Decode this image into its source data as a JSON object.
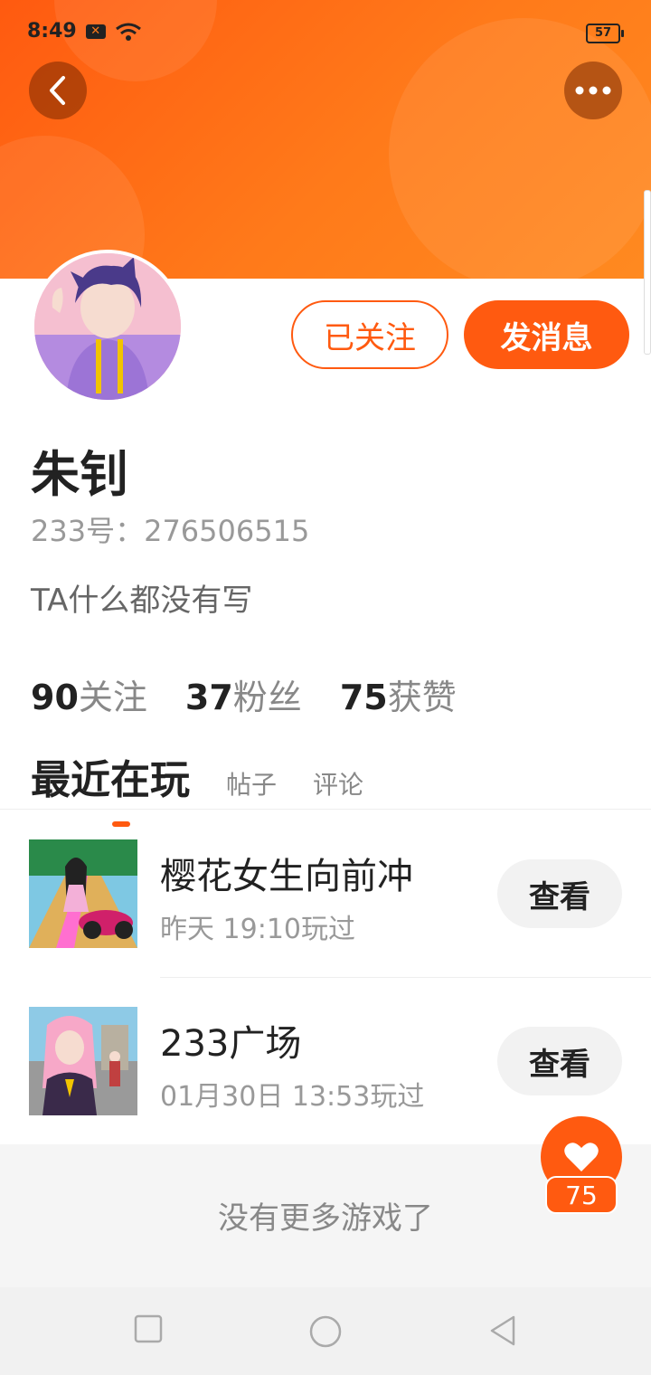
{
  "status_bar": {
    "time": "8:49",
    "battery": "57"
  },
  "profile": {
    "name": "朱钊",
    "uid": "233号：276506515",
    "bio": "TA什么都没有写",
    "follow_button": "已关注",
    "message_button": "发消息"
  },
  "stats": [
    {
      "value": "90",
      "label": "关注"
    },
    {
      "value": "37",
      "label": "粉丝"
    },
    {
      "value": "75",
      "label": "获赞"
    }
  ],
  "tabs": {
    "active": "最近在玩",
    "posts": "帖子",
    "comments": "评论"
  },
  "games": [
    {
      "title": "樱花女生向前冲",
      "played": "昨天 19:10玩过",
      "button": "查看"
    },
    {
      "title": "233广场",
      "played": "01月30日 13:53玩过",
      "button": "查看"
    }
  ],
  "footer": {
    "text": "没有更多游戏了"
  },
  "like": {
    "count": "75"
  },
  "colors": {
    "accent": "#ff5a10",
    "header_start": "#ff5a10",
    "header_end": "#ff8a20"
  }
}
